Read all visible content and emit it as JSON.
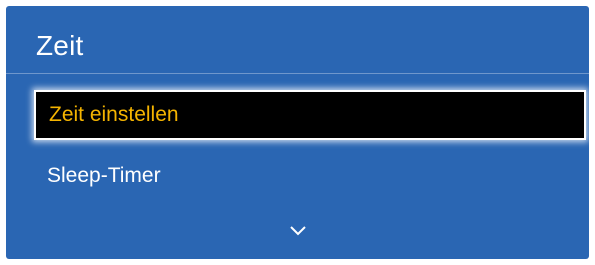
{
  "window": {
    "title": "Zeit"
  },
  "menu": {
    "items": [
      {
        "label": "Zeit einstellen",
        "selected": true
      },
      {
        "label": "Sleep-Timer",
        "selected": false
      }
    ],
    "more_indicator_icon": "chevron-down-icon"
  },
  "colors": {
    "panel_background": "#2a66b3",
    "selected_background": "#000000",
    "selected_text": "#f5b400",
    "text": "#ffffff"
  }
}
